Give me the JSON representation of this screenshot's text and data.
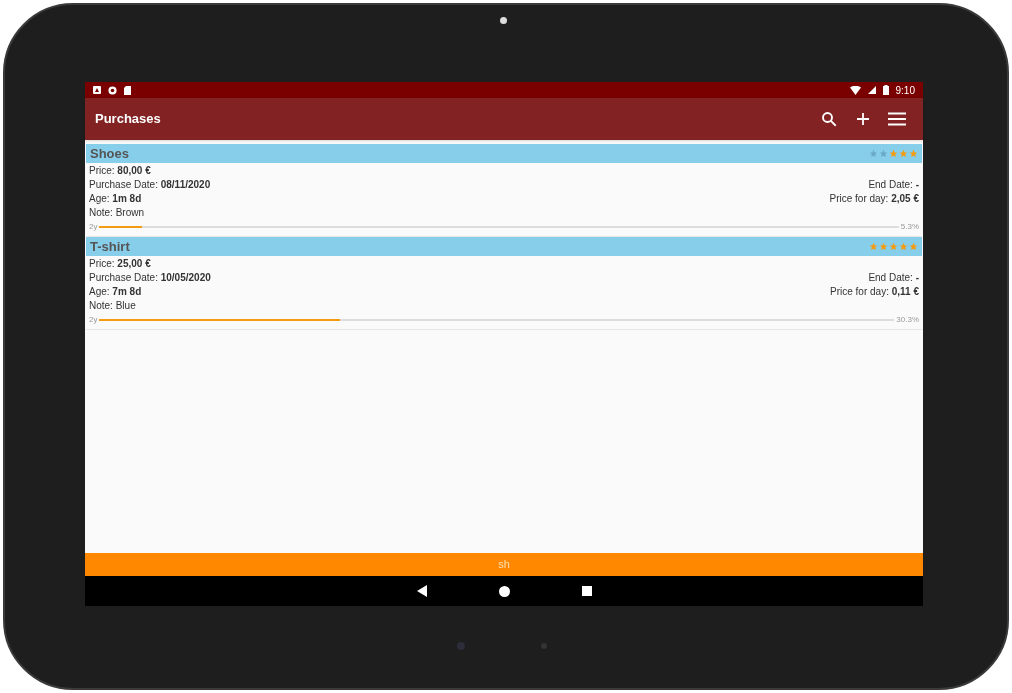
{
  "status_bar": {
    "time": "9:10"
  },
  "app_bar": {
    "title": "Purchases"
  },
  "items": [
    {
      "name": "Shoes",
      "stars": 3,
      "price": "Price: **80,00 €**",
      "purchase_date": "Purchase Date: **08/11/2020**",
      "end_date": "End Date: **-**",
      "age": "Age: **1m 8d**",
      "price_for_day": "Price for day: **2,05 €**",
      "note": "Note: Brown",
      "range": "2y",
      "level": 0.053,
      "percent": "5.3%"
    },
    {
      "name": "T-shirt",
      "stars": 5,
      "price": "Price: **25,00 €**",
      "purchase_date": "Purchase Date: **10/05/2020**",
      "end_date": "End Date: **-**",
      "age": "Age: **7m 8d**",
      "price_for_day": "Price for day: **0,11 €**",
      "note": "Note: Blue",
      "range": "2y",
      "level": 0.303,
      "percent": "30.3%"
    }
  ],
  "footer": {
    "text": "sh"
  }
}
